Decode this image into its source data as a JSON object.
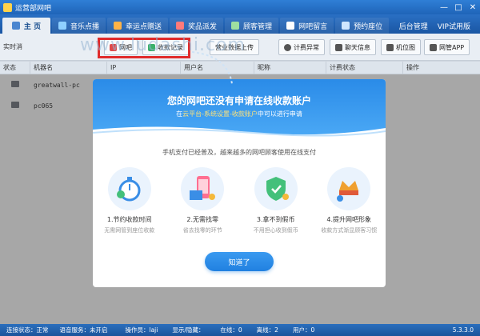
{
  "window": {
    "title": "运营部网吧",
    "minimize": "—",
    "maximize": "□",
    "close": "✕"
  },
  "nav": {
    "tabs": [
      {
        "label": "主 页",
        "color": "#1a4f8f"
      },
      {
        "label": "音乐点播",
        "color": "#8fd0ff"
      },
      {
        "label": "幸运点赠送",
        "color": "#ffb347"
      },
      {
        "label": "奖品派发",
        "color": "#ff7a7a"
      },
      {
        "label": "顾客管理",
        "color": "#9fe0a0"
      },
      {
        "label": "网吧留言",
        "color": "#ffffff"
      },
      {
        "label": "预约座位",
        "color": "#cfe6ff"
      }
    ],
    "admin": "后台管理",
    "trial": "VIP试用版"
  },
  "toolbar": {
    "left_label": "实时消",
    "buttons": [
      "网吧",
      "收款记录",
      "营业数据上传",
      "计费异常",
      "聊天信息",
      "机位图",
      "网管APP"
    ]
  },
  "watermark": "www.ludashi.com",
  "table": {
    "headers": [
      "状态",
      "机器名",
      "IP",
      "用户名",
      "昵称",
      "计费状态",
      "操作"
    ],
    "rows": [
      {
        "name": "greatwall-pc"
      },
      {
        "name": "pc065"
      }
    ]
  },
  "modal": {
    "title": "您的网吧还没有申请在线收款账户",
    "sub_prefix": "在",
    "sub_highlight": "云平台-系统设置-收款账户",
    "sub_suffix": "中可以进行申请",
    "desc": "手机支付已经普及，越来越多的网吧顾客使用在线支付",
    "features": [
      {
        "title": "1.节约收款时间",
        "desc": "无需网管到座位收款"
      },
      {
        "title": "2.无需找零",
        "desc": "省去找零的环节"
      },
      {
        "title": "3.拿不到假币",
        "desc": "不用担心收到假币"
      },
      {
        "title": "4.提升网吧形象",
        "desc": "收款方式渐显顾客习惯"
      }
    ],
    "ok": "知道了"
  },
  "status": {
    "conn": "连接状态：正常",
    "voice": "语音服务：未开启",
    "operator": "操作员：laji",
    "display": "显示/隐藏：",
    "online": "在线：0",
    "offline": "离线：2",
    "users": "用户：0",
    "version": "5.3.3.0"
  },
  "colors": {
    "accent": "#2080e0",
    "highlight_border": "#e02b2b"
  }
}
